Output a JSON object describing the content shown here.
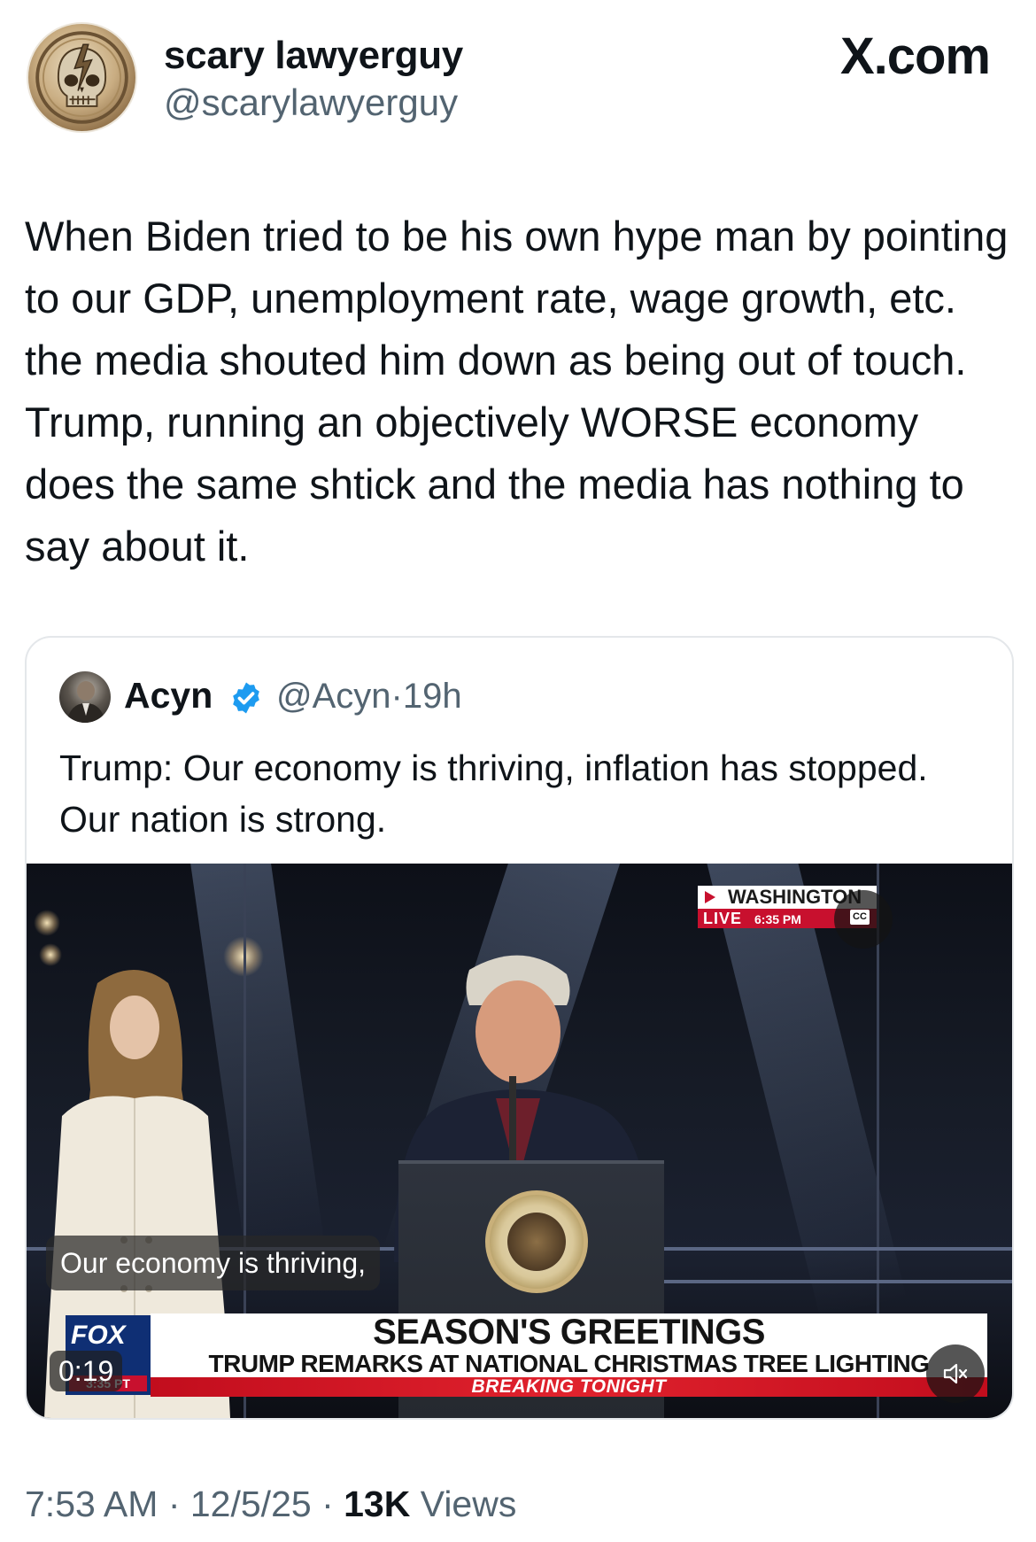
{
  "header": {
    "display_name": "scary lawyerguy",
    "handle": "@scarylawyerguy",
    "site_label": "X.com"
  },
  "tweet": {
    "text": "When Biden tried to be his own hype man by pointing to our GDP, unemployment rate, wage growth, etc. the media shouted him down as being out of touch. Trump, running an objectively WORSE economy does the same shtick and the media has nothing to say about it."
  },
  "quote": {
    "display_name": "Acyn",
    "handle": "@Acyn",
    "separator": "·",
    "age": "19h",
    "text": "Trump: Our economy is thriving, inflation has stopped. Our nation is strong.",
    "video": {
      "location": "WASHINGTON",
      "live_label": "LIVE",
      "live_time": "6:35 PM",
      "cc_label": "CC",
      "caption": "Our economy is thriving,",
      "chyron_title": "SEASON'S GREETINGS",
      "chyron_subtitle": "TRUMP REMARKS AT NATIONAL CHRISTMAS TREE LIGHTING",
      "chyron_breaking": "BREAKING TONIGHT",
      "network_logo": "FOX",
      "network_clock": "3:35 PT",
      "duration": "0:19"
    }
  },
  "footer": {
    "time": "7:53 AM",
    "dot1": " · ",
    "date": "12/5/25",
    "dot2": " · ",
    "views_count": "13K",
    "views_label": " Views"
  },
  "colors": {
    "text_primary": "#0f1419",
    "text_secondary": "#536471",
    "verified_blue": "#1d9bf0",
    "border": "#e4e7ea",
    "fox_red": "#c8102e",
    "fox_blue": "#0f2f74"
  }
}
